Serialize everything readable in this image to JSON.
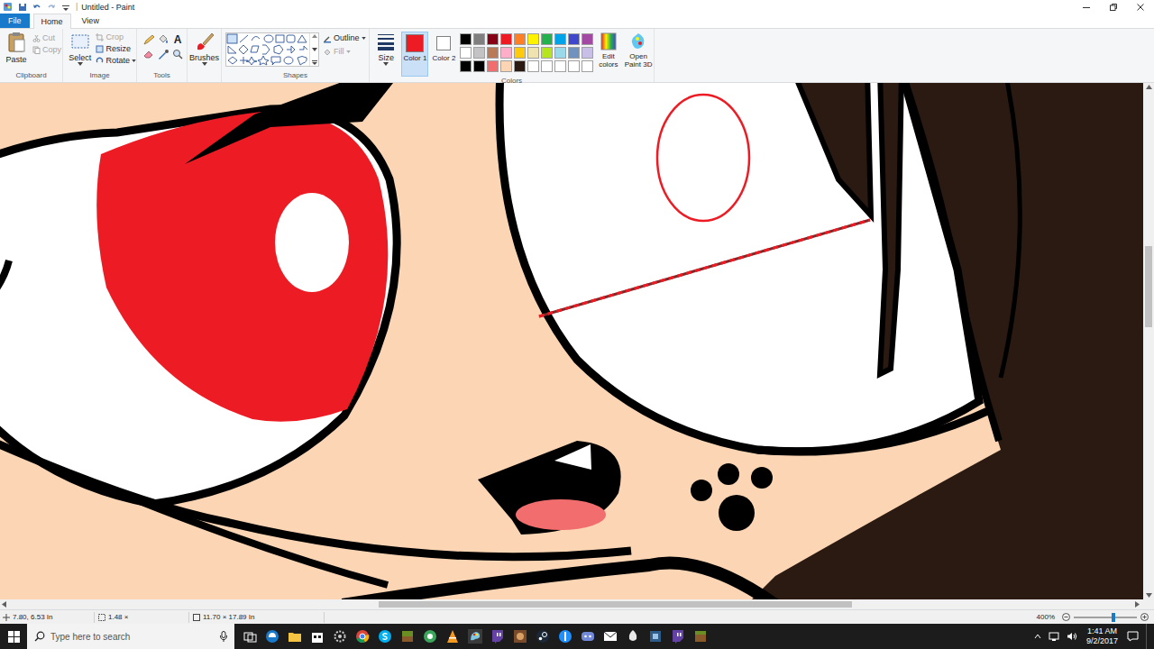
{
  "window": {
    "title": "Untitled - Paint"
  },
  "ribbon_tabs": [
    {
      "label": "File",
      "selected": false,
      "kind": "menu"
    },
    {
      "label": "Home",
      "selected": true,
      "kind": "tab"
    },
    {
      "label": "View",
      "selected": false,
      "kind": "tab"
    }
  ],
  "clipboard": {
    "label": "Clipboard",
    "paste": "Paste",
    "items": [
      {
        "label": "Cut",
        "disabled": true
      },
      {
        "label": "Copy",
        "disabled": true
      }
    ]
  },
  "image": {
    "label": "Image",
    "select": "Select",
    "items": [
      {
        "label": "Crop",
        "disabled": true
      },
      {
        "label": "Resize",
        "disabled": false
      },
      {
        "label": "Rotate",
        "disabled": false
      }
    ]
  },
  "tools": {
    "label": "Tools",
    "text_tool": "A"
  },
  "brushes": {
    "label": "Brushes"
  },
  "shapes": {
    "label": "Shapes",
    "outline": {
      "label": "Outline",
      "disabled": false
    },
    "fill": {
      "label": "Fill",
      "disabled": true
    }
  },
  "size": {
    "label": "Size"
  },
  "colors": {
    "label": "Colors",
    "slots": [
      {
        "label": "Color 1",
        "selected": true,
        "color": "#ed1c24"
      },
      {
        "label": "Color 2",
        "selected": false,
        "color": "#ffffff"
      }
    ],
    "palette": [
      {
        "color": "#000000"
      },
      {
        "color": "#7f7f7f"
      },
      {
        "color": "#880015"
      },
      {
        "color": "#ed1c24"
      },
      {
        "color": "#ff7f27"
      },
      {
        "color": "#fff200"
      },
      {
        "color": "#22b14c"
      },
      {
        "color": "#00a2e8"
      },
      {
        "color": "#3f48cc"
      },
      {
        "color": "#a349a4"
      },
      {
        "color": "#ffffff"
      },
      {
        "color": "#c3c3c3"
      },
      {
        "color": "#b97a57"
      },
      {
        "color": "#ffaec9"
      },
      {
        "color": "#ffc90e"
      },
      {
        "color": "#efe4b0"
      },
      {
        "color": "#b5e61d"
      },
      {
        "color": "#99d9ea"
      },
      {
        "color": "#7092be"
      },
      {
        "color": "#c8bfe7"
      },
      {
        "color": "#000000"
      },
      {
        "color": "#000000"
      },
      {
        "color": "#f26d6d"
      },
      {
        "color": "#fbd5b4"
      },
      {
        "color": "#2b1a12"
      },
      {
        "color": "#ffffff"
      },
      {
        "color": "#ffffff"
      },
      {
        "color": "#ffffff"
      },
      {
        "color": "#ffffff"
      },
      {
        "color": "#ffffff"
      }
    ],
    "edit_colors": "Edit colors",
    "paint3d": "Open Paint 3D"
  },
  "status_bar": {
    "cursor": "7.80, 6.53 In",
    "selection": "1.48 ×",
    "canvas_size": "11.70 × 17.89 In",
    "zoom": "400%",
    "zoom_level": 0.63
  },
  "taskbar": {
    "search": {
      "placeholder": "Type here to search"
    },
    "time": "1:41 AM",
    "date": "9/2/2017"
  }
}
